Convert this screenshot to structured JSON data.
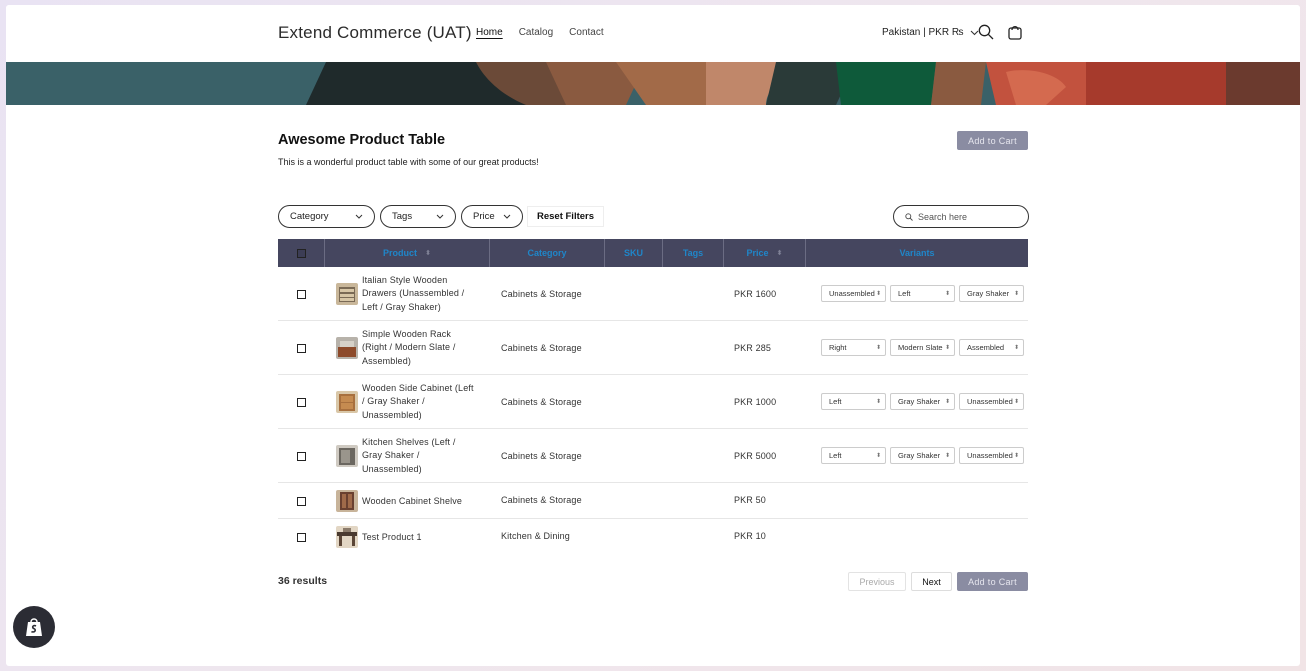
{
  "header": {
    "brand": "Extend Commerce (UAT)",
    "nav": [
      "Home",
      "Catalog",
      "Contact"
    ],
    "country": "Pakistan | PKR ₨"
  },
  "content": {
    "title": "Awesome Product Table",
    "subtitle": "This is a wonderful product table with some of our great products!",
    "add_to_cart": "Add to Cart"
  },
  "filters": {
    "category": "Category",
    "tags": "Tags",
    "price": "Price",
    "reset": "Reset Filters",
    "search_placeholder": "Search here"
  },
  "table": {
    "columns": [
      "Product",
      "Category",
      "SKU",
      "Tags",
      "Price",
      "Variants"
    ],
    "rows": [
      {
        "name": "Italian Style Wooden Drawers (Unassembled / Left / Gray Shaker)",
        "category": "Cabinets & Storage",
        "price": "PKR 1600",
        "variants": [
          "Unassembled",
          "Left",
          "Gray Shaker"
        ]
      },
      {
        "name": "Simple Wooden Rack (Right / Modern Slate / Assembled)",
        "category": "Cabinets & Storage",
        "price": "PKR 285",
        "variants": [
          "Right",
          "Modern Slate",
          "Assembled"
        ]
      },
      {
        "name": "Wooden Side Cabinet (Left / Gray Shaker / Unassembled)",
        "category": "Cabinets & Storage",
        "price": "PKR 1000",
        "variants": [
          "Left",
          "Gray Shaker",
          "Unassembled"
        ]
      },
      {
        "name": "Kitchen Shelves (Left / Gray Shaker / Unassembled)",
        "category": "Cabinets & Storage",
        "price": "PKR 5000",
        "variants": [
          "Left",
          "Gray Shaker",
          "Unassembled"
        ]
      },
      {
        "name": "Wooden Cabinet Shelve",
        "category": "Cabinets & Storage",
        "price": "PKR 50",
        "variants": []
      },
      {
        "name": "Test Product 1",
        "category": "Kitchen & Dining",
        "price": "PKR 10",
        "variants": []
      }
    ]
  },
  "footer": {
    "results": "36 results",
    "previous": "Previous",
    "next": "Next",
    "add_to_cart": "Add to Cart"
  },
  "colors": {
    "table_header_bg": "#45465f",
    "table_header_text": "#1f86c9",
    "button_disabled": "#8a8ca2",
    "banner_bg": "#3a6168"
  },
  "icons": [
    "search-icon",
    "cart-icon",
    "chevron-down-icon",
    "shopify-icon"
  ]
}
